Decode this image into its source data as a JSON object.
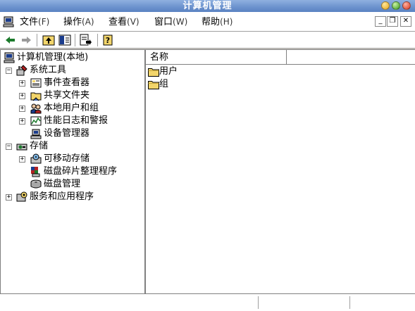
{
  "window": {
    "title": "计算机管理"
  },
  "menu": [
    {
      "label": "文件",
      "accel": "(F)"
    },
    {
      "label": "操作",
      "accel": "(A)"
    },
    {
      "label": "查看",
      "accel": "(V)"
    },
    {
      "label": "窗口",
      "accel": "(W)"
    },
    {
      "label": "帮助",
      "accel": "(H)"
    }
  ],
  "mdi_controls": {
    "minimize": "_",
    "restore": "❐",
    "close": "✕"
  },
  "toolbar": {
    "back": "back-arrow-icon",
    "forward": "forward-arrow-icon",
    "up": "folder-up-icon",
    "show_tree": "show-hide-tree-icon",
    "export": "export-list-icon",
    "help": "help-icon"
  },
  "tree": {
    "root": "计算机管理(本地)",
    "system_tools": "系统工具",
    "event_viewer": "事件查看器",
    "shared_folders": "共享文件夹",
    "local_users": "本地用户和组",
    "perf_logs": "性能日志和警报",
    "device_manager": "设备管理器",
    "storage": "存储",
    "removable_storage": "可移动存储",
    "defrag": "磁盘碎片整理程序",
    "disk_mgmt": "磁盘管理",
    "services_apps": "服务和应用程序"
  },
  "list": {
    "column_name": "名称",
    "items": [
      "用户",
      "组"
    ]
  },
  "colors": {
    "titlebar": "#6e94cf",
    "folder": "#f2d56b"
  }
}
